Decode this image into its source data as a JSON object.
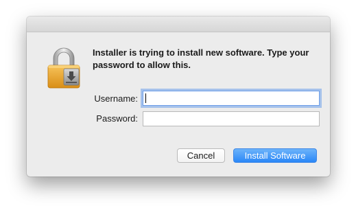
{
  "dialog": {
    "message": "Installer is trying to install new software. Type your password to allow this.",
    "icon": "lock-installer-icon"
  },
  "fields": {
    "username_label": "Username:",
    "username_value": "",
    "password_label": "Password:",
    "password_value": ""
  },
  "buttons": {
    "cancel_label": "Cancel",
    "install_label": "Install Software"
  },
  "colors": {
    "accent": "#2a87f7",
    "focus_ring": "#6ea0eb",
    "dialog_bg": "#ececec"
  }
}
